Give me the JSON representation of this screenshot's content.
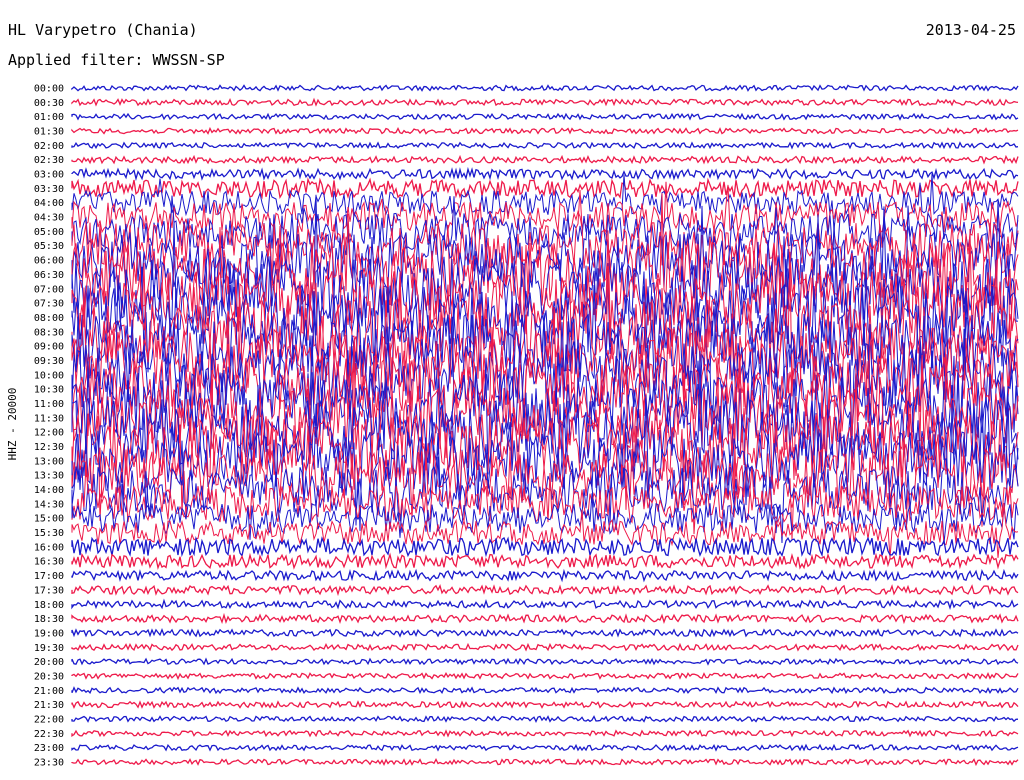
{
  "header": {
    "station": "HL Varypetro (Chania)",
    "date": "2013-04-25",
    "filter": "Applied filter: WWSSN-SP",
    "channel_label": "HHZ - 20000"
  },
  "chart_data": {
    "type": "line",
    "title": "HL Varypetro (Chania)",
    "subtitle": "Applied filter: WWSSN-SP",
    "ylabel": "HHZ - 20000",
    "xlabel": "",
    "grid": false,
    "colors": {
      "trace_a": "#1a1acc",
      "trace_b": "#ee1a4a"
    },
    "series_color_order": [
      "trace_a",
      "trace_b"
    ],
    "rows": [
      {
        "label": "00:00",
        "activity": 0.05
      },
      {
        "label": "00:30",
        "activity": 0.06
      },
      {
        "label": "01:00",
        "activity": 0.05
      },
      {
        "label": "01:30",
        "activity": 0.05
      },
      {
        "label": "02:00",
        "activity": 0.05
      },
      {
        "label": "02:30",
        "activity": 0.07
      },
      {
        "label": "03:00",
        "activity": 0.12
      },
      {
        "label": "03:30",
        "activity": 0.25
      },
      {
        "label": "04:00",
        "activity": 0.35
      },
      {
        "label": "04:30",
        "activity": 0.45
      },
      {
        "label": "05:00",
        "activity": 0.55
      },
      {
        "label": "05:30",
        "activity": 0.7
      },
      {
        "label": "06:00",
        "activity": 0.85
      },
      {
        "label": "06:30",
        "activity": 1.0
      },
      {
        "label": "07:00",
        "activity": 1.0
      },
      {
        "label": "07:30",
        "activity": 1.0
      },
      {
        "label": "08:00",
        "activity": 1.0
      },
      {
        "label": "08:30",
        "activity": 1.0
      },
      {
        "label": "09:00",
        "activity": 1.0
      },
      {
        "label": "09:30",
        "activity": 1.0
      },
      {
        "label": "10:00",
        "activity": 1.0
      },
      {
        "label": "10:30",
        "activity": 1.0
      },
      {
        "label": "11:00",
        "activity": 1.0
      },
      {
        "label": "11:30",
        "activity": 1.0
      },
      {
        "label": "12:00",
        "activity": 1.0
      },
      {
        "label": "12:30",
        "activity": 1.0
      },
      {
        "label": "13:00",
        "activity": 0.9
      },
      {
        "label": "13:30",
        "activity": 0.8
      },
      {
        "label": "14:00",
        "activity": 0.7
      },
      {
        "label": "14:30",
        "activity": 0.55
      },
      {
        "label": "15:00",
        "activity": 0.45
      },
      {
        "label": "15:30",
        "activity": 0.35
      },
      {
        "label": "16:00",
        "activity": 0.25
      },
      {
        "label": "16:30",
        "activity": 0.18
      },
      {
        "label": "17:00",
        "activity": 0.12
      },
      {
        "label": "17:30",
        "activity": 0.1
      },
      {
        "label": "18:00",
        "activity": 0.08
      },
      {
        "label": "18:30",
        "activity": 0.08
      },
      {
        "label": "19:00",
        "activity": 0.07
      },
      {
        "label": "19:30",
        "activity": 0.06
      },
      {
        "label": "20:00",
        "activity": 0.05
      },
      {
        "label": "20:30",
        "activity": 0.05
      },
      {
        "label": "21:00",
        "activity": 0.05
      },
      {
        "label": "21:30",
        "activity": 0.06
      },
      {
        "label": "22:00",
        "activity": 0.05
      },
      {
        "label": "22:30",
        "activity": 0.05
      },
      {
        "label": "23:00",
        "activity": 0.05
      },
      {
        "label": "23:30",
        "activity": 0.05
      }
    ]
  }
}
